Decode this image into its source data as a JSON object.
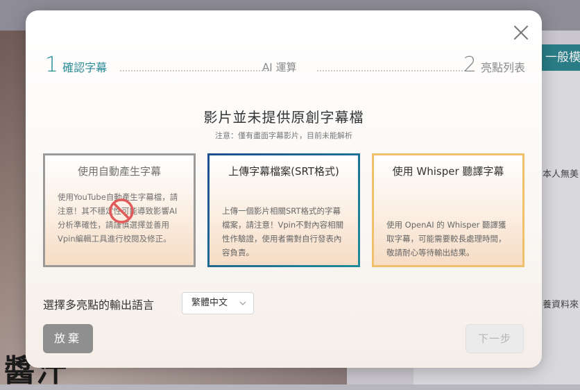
{
  "background": {
    "photo_text": "醬汁",
    "tag_text": "一般模式",
    "snippet_1": "本人無美",
    "snippet_2": "養資料來"
  },
  "steps": [
    {
      "number": "1",
      "label": "確認字幕"
    },
    {
      "number": "",
      "label": "AI 運算"
    },
    {
      "number": "2",
      "label": "亮點列表"
    }
  ],
  "heading": {
    "title": "影片並未提供原創字幕檔",
    "subtitle": "注意：僅有盡面字幕影片，目前未能解析"
  },
  "options": [
    {
      "title": "使用自動產生字幕",
      "description": "使用YouTube自動產生字幕檔，請注意！其不穩定性可能導致影響AI分析準確性，請謹慎選擇並善用Vpin編輯工具進行校閱及修正。",
      "disabled": true
    },
    {
      "title": "上傳字幕檔案(SRT格式)",
      "description": "上傳一個影片相關SRT格式的字幕檔案，請注意！Vpin不對內容相關性作驗證，使用者需對自行發表內容負責。",
      "disabled": false
    },
    {
      "title": "使用 Whisper 聽譯字幕",
      "description": "使用 OpenAI 的 Whisper 聽譯獲取字幕，可能需要較長處理時間，敬請耐心等待輸出結果。",
      "disabled": false
    }
  ],
  "language": {
    "label": "選擇多亮點的輸出語言",
    "selected": "繁體中文"
  },
  "buttons": {
    "abandon": "放棄",
    "next": "下一步"
  },
  "colors": {
    "accent": "#2a8a98",
    "card_srt_border": "#1d5f8a",
    "card_whisper_border": "#f1c06a",
    "abandon_button": "#8f8f8f"
  },
  "icons": {
    "close": "close-icon",
    "forbidden": "forbidden-icon",
    "dropdown": "chevron-down-icon"
  }
}
